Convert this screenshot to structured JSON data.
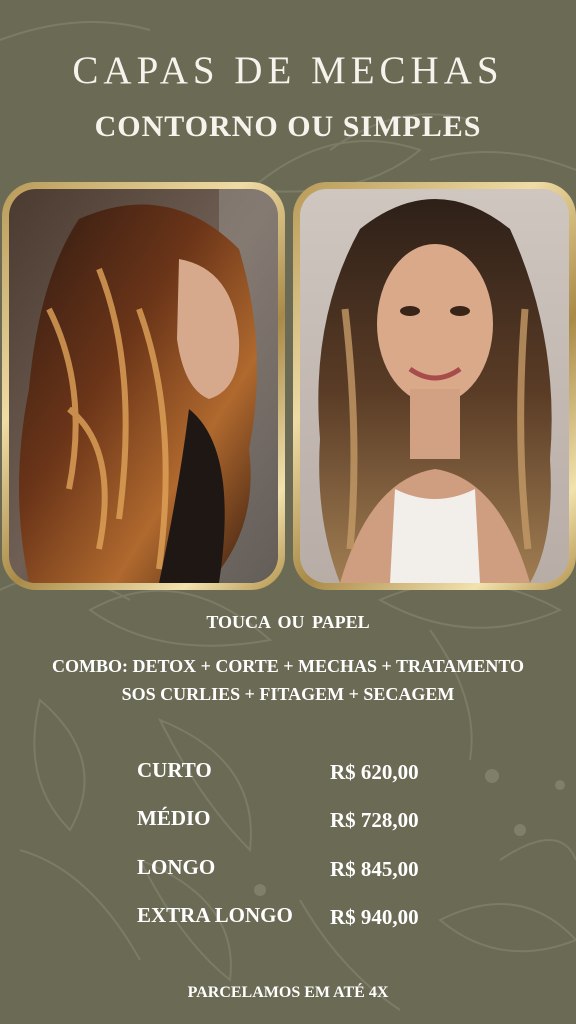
{
  "header": {
    "title": "CAPAS DE MECHAS",
    "subtitle": "CONTORNO OU SIMPLES"
  },
  "images": {
    "left_photo": "woman-with-long-wavy-dark-brown-hair-caramel-highlights",
    "right_photo": "smiling-woman-with-long-wavy-balayage-hair"
  },
  "details": {
    "method": "TOUCA  OU  PAPEL",
    "combo_line1": "COMBO: DETOX +  CORTE + MECHAS  +  TRATAMENTO",
    "combo_line2": "SOS CURLIES + FITAGEM + SECAGEM"
  },
  "prices": [
    {
      "size": "CURTO",
      "price": "R$ 620,00"
    },
    {
      "size": "MÉDIO",
      "price": "R$ 728,00"
    },
    {
      "size": "LONGO",
      "price": "R$ 845,00"
    },
    {
      "size": "EXTRA LONGO",
      "price": "R$ 940,00"
    }
  ],
  "footer": {
    "installments": "PARCELAMOS EM ATÉ 4X"
  },
  "colors": {
    "background": "#6b6b55",
    "frame_gold": "#d9c283",
    "text": "#ffffff"
  }
}
